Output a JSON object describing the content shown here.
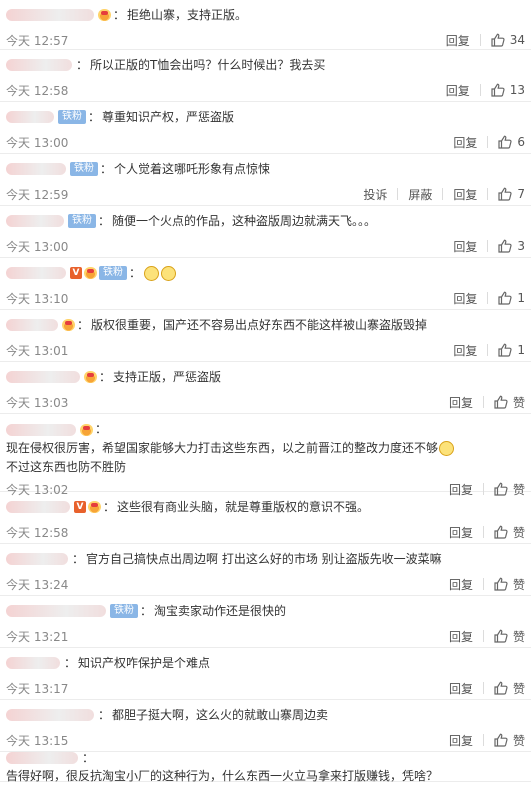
{
  "reply_label": "回复",
  "report_label": "投诉",
  "block_label": "屏蔽",
  "fan_badge_label": "铁粉",
  "comments": [
    {
      "name_w": 88,
      "badges": [
        "crown"
      ],
      "text": "拒绝山寨，支持正版。",
      "time": "今天 12:57",
      "likes": "34",
      "extra_actions": false
    },
    {
      "name_w": 66,
      "badges": [],
      "text": "所以正版的T恤会出吗？什么时候出？我去买",
      "time": "今天 12:58",
      "likes": "13",
      "extra_actions": false
    },
    {
      "name_w": 48,
      "badges": [
        "fan"
      ],
      "text": "尊重知识产权，严惩盗版",
      "time": "今天 13:00",
      "likes": "6",
      "extra_actions": false
    },
    {
      "name_w": 60,
      "badges": [
        "fan"
      ],
      "text": "个人觉着这哪吒形象有点惊悚",
      "time": "今天 12:59",
      "likes": "7",
      "extra_actions": true
    },
    {
      "name_w": 58,
      "badges": [
        "fan"
      ],
      "text": "随便一个火点的作品，这种盗版周边就满天飞。。。",
      "time": "今天 13:00",
      "likes": "3",
      "extra_actions": false
    },
    {
      "name_w": 60,
      "badges": [
        "v",
        "crown",
        "fan"
      ],
      "text": "",
      "emoji_only": true,
      "time": "今天 13:10",
      "likes": "1",
      "extra_actions": false
    },
    {
      "name_w": 52,
      "badges": [
        "crown"
      ],
      "text": "版权很重要，国产还不容易出点好东西不能这样被山寨盗版毁掉",
      "time": "今天 13:01",
      "likes": "1",
      "extra_actions": false
    },
    {
      "name_w": 74,
      "badges": [
        "crown"
      ],
      "text": "支持正版，严惩盗版",
      "time": "今天 13:03",
      "likes": "赞",
      "extra_actions": false
    },
    {
      "name_w": 70,
      "badges": [
        "crown"
      ],
      "text": "现在侵权很厉害，希望国家能够大力打击这些东西，以之前晋江的整改力度还不够",
      "text2": "不过这东西也防不胜防",
      "time": "今天 13:02",
      "likes": "赞",
      "extra_actions": false
    },
    {
      "name_w": 64,
      "badges": [
        "v",
        "crown"
      ],
      "text": "这些很有商业头脑，就是尊重版权的意识不强。",
      "time": "今天 12:58",
      "likes": "赞",
      "extra_actions": false
    },
    {
      "name_w": 62,
      "badges": [],
      "text": "官方自己搞快点出周边啊 打出这么好的市场 别让盗版先收一波菜嘛",
      "time": "今天 13:24",
      "likes": "赞",
      "extra_actions": false
    },
    {
      "name_w": 100,
      "badges": [
        "fan"
      ],
      "text": "淘宝卖家动作还是很快的",
      "time": "今天 13:21",
      "likes": "赞",
      "extra_actions": false
    },
    {
      "name_w": 54,
      "badges": [],
      "text": "知识产权咋保护是个难点",
      "time": "今天 13:17",
      "likes": "赞",
      "extra_actions": false
    },
    {
      "name_w": 88,
      "badges": [],
      "text": "都胆子挺大啊，这么火的就敢山寨周边卖",
      "time": "今天 13:15",
      "likes": "赞",
      "extra_actions": false
    },
    {
      "name_w": 72,
      "badges": [],
      "text": "告得好啊，很反抗淘宝小厂的这种行为，什么东西一火立马拿来打版赚钱，凭啥？",
      "time": "",
      "likes": "",
      "extra_actions": false
    }
  ]
}
